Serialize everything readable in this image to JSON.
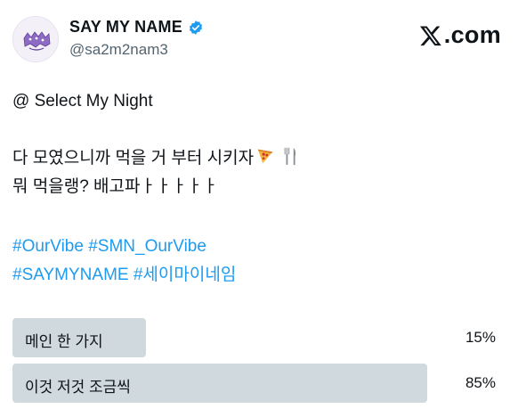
{
  "author": {
    "display_name": "SAY MY NAME",
    "handle": "@sa2m2nam3",
    "verified_icon": "verified-badge-icon",
    "avatar_icon": "purple-logo-avatar"
  },
  "brand": {
    "logo_icon": "x-logo-icon",
    "text": ".com"
  },
  "post": {
    "line1": "@ Select My Night",
    "line2": "다 모였으니까 먹을 거 부터 시키자",
    "line2_emojis": [
      "pizza-emoji",
      "fork-knife-emoji"
    ],
    "line3": "뭐 먹을랭? 배고파ㅏㅏㅏㅏㅏ",
    "hashtags_line1": [
      "#OurVibe",
      "#SMN_OurVibe"
    ],
    "hashtags_line2": [
      "#SAYMYNAME",
      "#세이마이네임"
    ]
  },
  "poll": {
    "options": [
      {
        "label": "메인 한 가지",
        "percent_text": "15%",
        "fraction": 0.15
      },
      {
        "label": "이것 저것 조금씩",
        "percent_text": "85%",
        "fraction": 0.85
      }
    ]
  },
  "colors": {
    "link": "#1d9bf0",
    "verified": "#1d9bf0",
    "poll_bar": "#cfd9de",
    "secondary_text": "#536471"
  }
}
